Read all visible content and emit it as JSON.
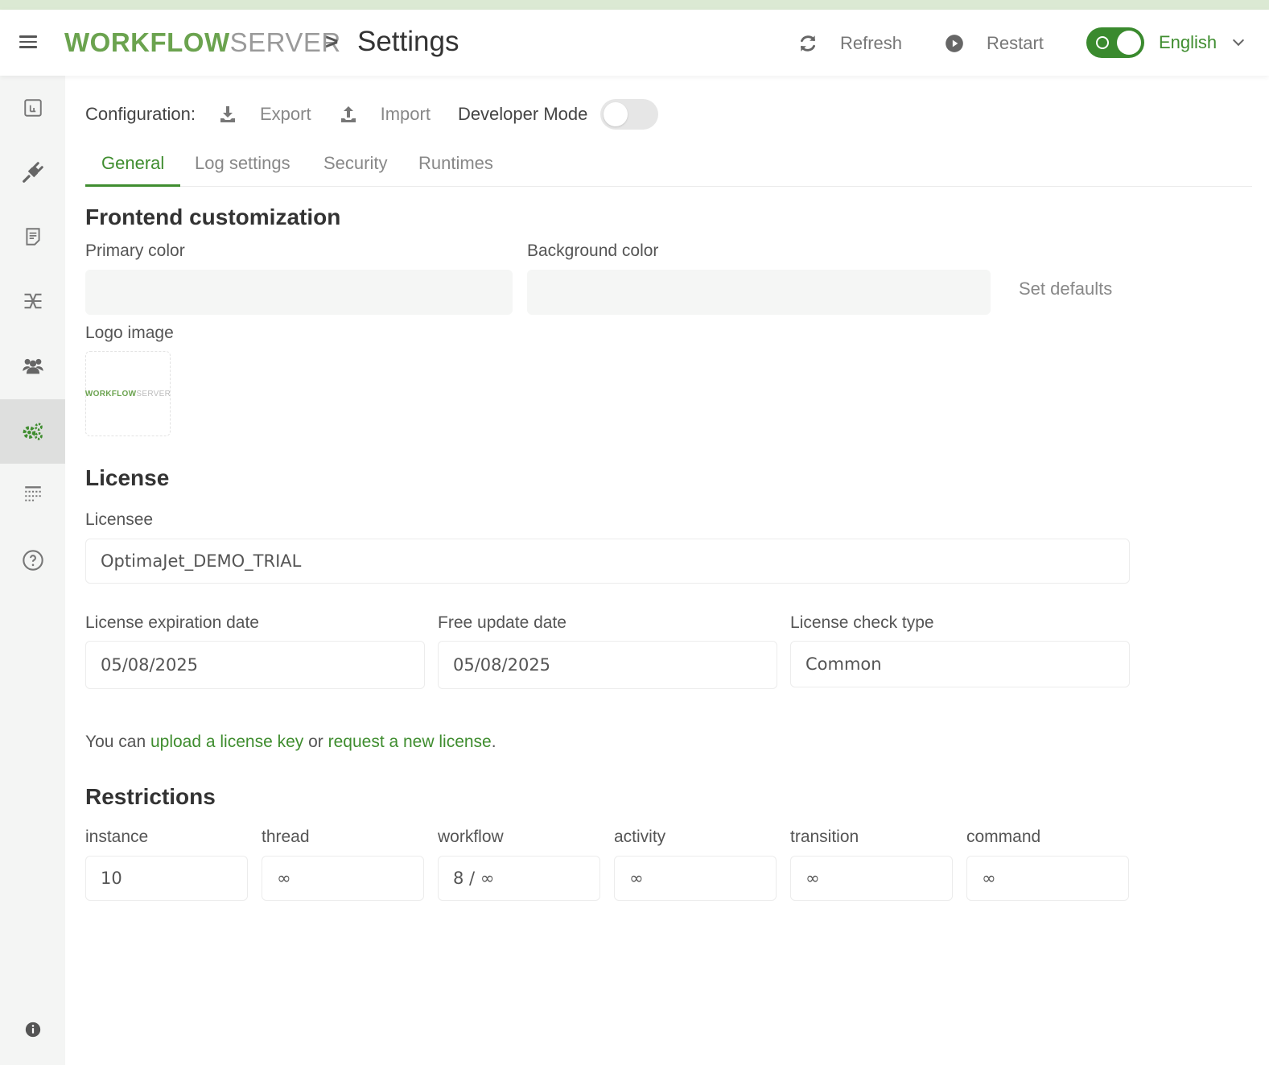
{
  "header": {
    "brand_primary": "WORKFLOW",
    "brand_secondary": "SERVER",
    "breadcrumb_separator": ">",
    "page_title": "Settings",
    "refresh_label": "Refresh",
    "restart_label": "Restart",
    "language": "English",
    "theme_toggle_on": true
  },
  "sidebar": {
    "items": [
      {
        "icon": "dashboard-icon"
      },
      {
        "icon": "plug-icon"
      },
      {
        "icon": "document-icon"
      },
      {
        "icon": "workflow-icon"
      },
      {
        "icon": "users-icon"
      },
      {
        "icon": "settings-gears-icon",
        "active": true
      },
      {
        "icon": "table-icon"
      },
      {
        "icon": "help-icon"
      }
    ],
    "footer_icon": "info-icon"
  },
  "config": {
    "label": "Configuration:",
    "export_label": "Export",
    "import_label": "Import",
    "developer_mode_label": "Developer Mode",
    "developer_mode_on": false
  },
  "tabs": [
    {
      "label": "General",
      "active": true
    },
    {
      "label": "Log settings"
    },
    {
      "label": "Security"
    },
    {
      "label": "Runtimes"
    }
  ],
  "frontend": {
    "title": "Frontend customization",
    "primary_color_label": "Primary color",
    "primary_color_value": "",
    "background_color_label": "Background color",
    "background_color_value": "",
    "set_defaults_label": "Set defaults",
    "logo_label": "Logo image",
    "logo_text_primary": "WORKFLOW",
    "logo_text_secondary": "SERVER"
  },
  "license": {
    "title": "License",
    "licensee_label": "Licensee",
    "licensee_value": "OptimaJet_DEMO_TRIAL",
    "expiration_label": "License expiration date",
    "expiration_value": "05/08/2025",
    "free_update_label": "Free update date",
    "free_update_value": "05/08/2025",
    "check_type_label": "License check type",
    "check_type_value": "Common",
    "note_prefix": "You can ",
    "upload_link": "upload a license key",
    "note_middle": " or ",
    "request_link": "request a new license",
    "note_suffix": "."
  },
  "restrictions": {
    "title": "Restrictions",
    "items": [
      {
        "label": "instance",
        "value": "10"
      },
      {
        "label": "thread",
        "value": "∞"
      },
      {
        "label": "workflow",
        "value": "8 / ∞"
      },
      {
        "label": "activity",
        "value": "∞"
      },
      {
        "label": "transition",
        "value": "∞"
      },
      {
        "label": "command",
        "value": "∞"
      }
    ]
  },
  "colors": {
    "accent": "#3f8d2f",
    "brand_green": "#6ba34f",
    "top_strip": "#dbe9d3"
  }
}
